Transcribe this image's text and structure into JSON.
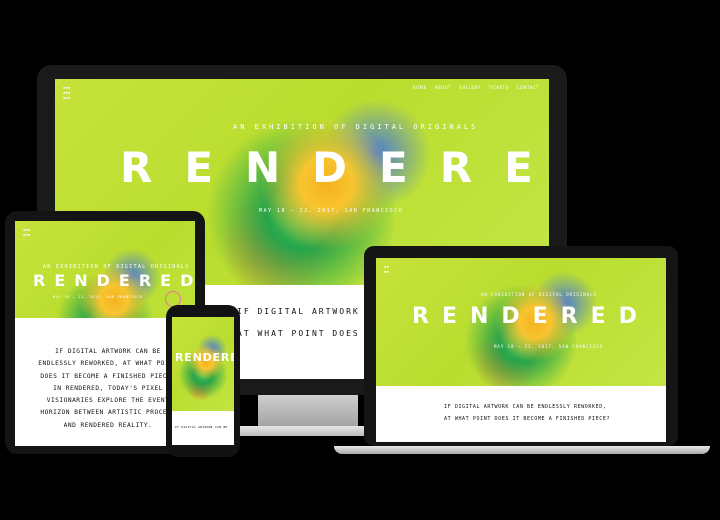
{
  "desktop": {
    "nav": [
      "HOME",
      "ABOUT",
      "GALLERY",
      "TICKETS",
      "CONTACT"
    ],
    "tagline": "AN EXHIBITION OF DIGITAL ORIGINALS",
    "title": "RENDERED",
    "dates": "MAY 18 – 22, 2017, SAN FRANCISCO",
    "body_line1": "IF DIGITAL ARTWORK CAN BE ENDLESSLY RE",
    "body_line2": "AT WHAT POINT DOES IT BECOME A FINISHE"
  },
  "tablet": {
    "tagline": "AN EXHIBITION OF DIGITAL ORIGINALS",
    "title": "RENDERED",
    "dates": "MAY 18 – 22, 2017, SAN FRANCISCO",
    "paragraph": [
      "IF DIGITAL ARTWORK CAN BE",
      "ENDLESSLY REWORKED, AT WHAT POINT",
      "DOES IT BECOME A FINISHED PIECE?",
      "IN RENDERED, TODAY'S PIXEL",
      "VISIONARIES EXPLORE THE EVENT",
      "HORIZON BETWEEN ARTISTIC PROCESS",
      "AND RENDERED REALITY."
    ]
  },
  "phone": {
    "title": "RENDERED",
    "body": "IF DIGITAL ARTWORK CAN BE"
  },
  "laptop": {
    "title": "RENDERED",
    "tagline": "AN EXHIBITION OF DIGITAL ORIGINALS",
    "dates": "MAY 18 – 22, 2017, SAN FRANCISCO",
    "body_line1": "IF DIGITAL ARTWORK CAN BE ENDLESSLY REWORKED,",
    "body_line2": "AT WHAT POINT DOES IT BECOME A FINISHED PIECE?"
  },
  "colors": {
    "lime": "#c4e23a",
    "accent_pink": "#f06f9b",
    "device": "#1a1a1a"
  }
}
